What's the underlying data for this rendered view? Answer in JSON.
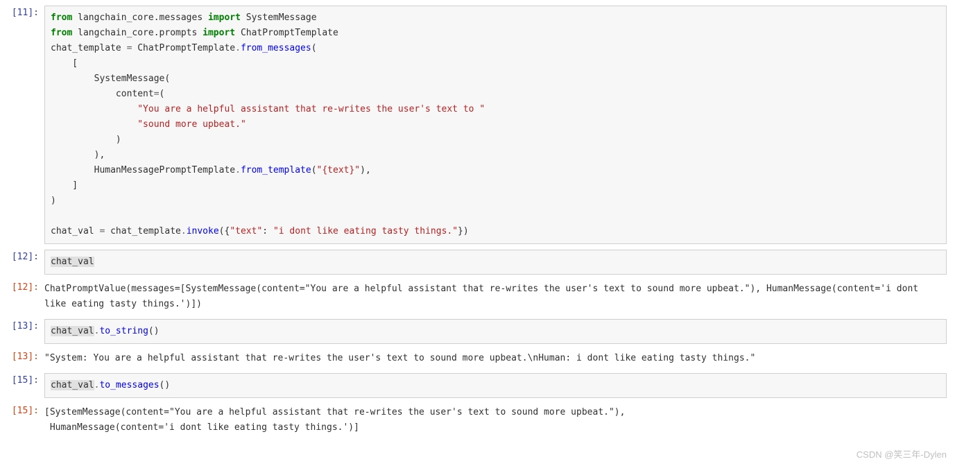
{
  "cells": [
    {
      "prompt": "[11]:",
      "type": "input",
      "code": {
        "t11_l1_from": "from",
        "t11_l1_mod": " langchain_core.messages ",
        "t11_l1_imp": "import",
        "t11_l1_sym": " SystemMessage",
        "t11_l2_from": "from",
        "t11_l2_mod": " langchain_core.prompts ",
        "t11_l2_imp": "import",
        "t11_l2_sym": " ChatPromptTemplate",
        "t11_l3_var": "chat_template ",
        "t11_l3_eq": "=",
        "t11_l3_cls": " ChatPromptTemplate",
        "t11_l3_dot": ".",
        "t11_l3_fn": "from_messages",
        "t11_l3_op": "(",
        "t11_l4": "    [",
        "t11_l5": "        SystemMessage(",
        "t11_l6_pre": "            content",
        "t11_l6_eq": "=",
        "t11_l6_op": "(",
        "t11_l7_pre": "                ",
        "t11_l7_str": "\"You are a helpful assistant that re-writes the user's text to \"",
        "t11_l8_pre": "                ",
        "t11_l8_str": "\"sound more upbeat.\"",
        "t11_l9": "            )",
        "t11_l10": "        ),",
        "t11_l11_pre": "        HumanMessagePromptTemplate",
        "t11_l11_dot": ".",
        "t11_l11_fn": "from_template",
        "t11_l11_op": "(",
        "t11_l11_str": "\"{text}\"",
        "t11_l11_cl": "),",
        "t11_l12": "    ]",
        "t11_l13": ")",
        "t11_blank": "",
        "t11_l14_var": "chat_val ",
        "t11_l14_eq": "=",
        "t11_l14_obj": " chat_template",
        "t11_l14_dot": ".",
        "t11_l14_fn": "invoke",
        "t11_l14_op": "({",
        "t11_l14_key": "\"text\"",
        "t11_l14_col": ": ",
        "t11_l14_val": "\"i dont like eating tasty things.\"",
        "t11_l14_cl": "})"
      }
    },
    {
      "prompt": "[12]:",
      "type": "input",
      "simple": "chat_val"
    },
    {
      "prompt": "[12]:",
      "type": "output",
      "text": "ChatPromptValue(messages=[SystemMessage(content=\"You are a helpful assistant that re-writes the user's text to sound more upbeat.\"), HumanMessage(content='i dont like eating tasty things.')])"
    },
    {
      "prompt": "[13]:",
      "type": "input",
      "code2": {
        "var": "chat_val",
        "dot": ".",
        "fn": "to_string",
        "pcl": "()"
      }
    },
    {
      "prompt": "[13]:",
      "type": "output",
      "text": "\"System: You are a helpful assistant that re-writes the user's text to sound more upbeat.\\nHuman: i dont like eating tasty things.\""
    },
    {
      "prompt": "[15]:",
      "type": "input",
      "code2": {
        "var": "chat_val",
        "dot": ".",
        "fn": "to_messages",
        "pcl": "()"
      }
    },
    {
      "prompt": "[15]:",
      "type": "output",
      "text": "[SystemMessage(content=\"You are a helpful assistant that re-writes the user's text to sound more upbeat.\"),\n HumanMessage(content='i dont like eating tasty things.')]"
    }
  ],
  "watermark": "CSDN @笑三年-Dylen"
}
